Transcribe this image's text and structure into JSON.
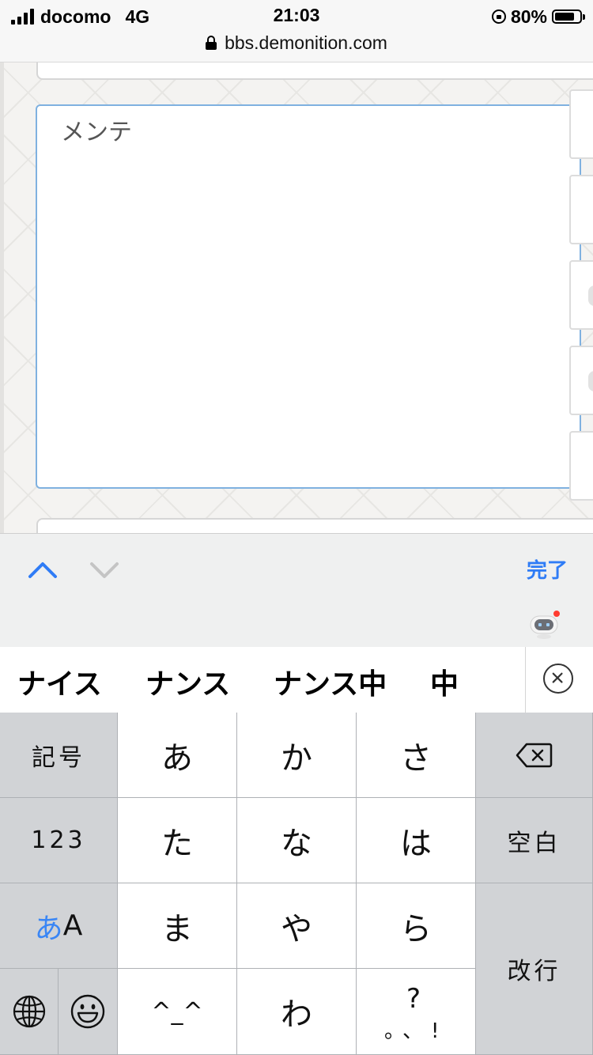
{
  "status_bar": {
    "carrier": "docomo",
    "network": "4G",
    "time": "21:03",
    "battery_percent": "80%",
    "battery_level": 0.8,
    "url": "bbs.demonition.com"
  },
  "page": {
    "textarea_value": "メンテ"
  },
  "accessory": {
    "done_label": "完了",
    "up_icon": "chevron-up-icon",
    "down_icon": "chevron-down-icon"
  },
  "candidates": [
    "ナイス",
    "ナンス",
    "ナンス中",
    "中"
  ],
  "keyboard": {
    "symbols": "記号",
    "numbers": "123",
    "mode_hira": "あ",
    "mode_alpha": "A",
    "space": "空白",
    "return": "改行",
    "kana": [
      "あ",
      "か",
      "さ",
      "た",
      "な",
      "は",
      "ま",
      "や",
      "ら",
      "わ"
    ],
    "emoticon": "^_^",
    "punct_top": "?",
    "punct_bottom": "。、!",
    "colors": {
      "accent": "#2f7cf6",
      "key_white": "#ffffff",
      "key_gray": "#d1d3d6"
    }
  }
}
